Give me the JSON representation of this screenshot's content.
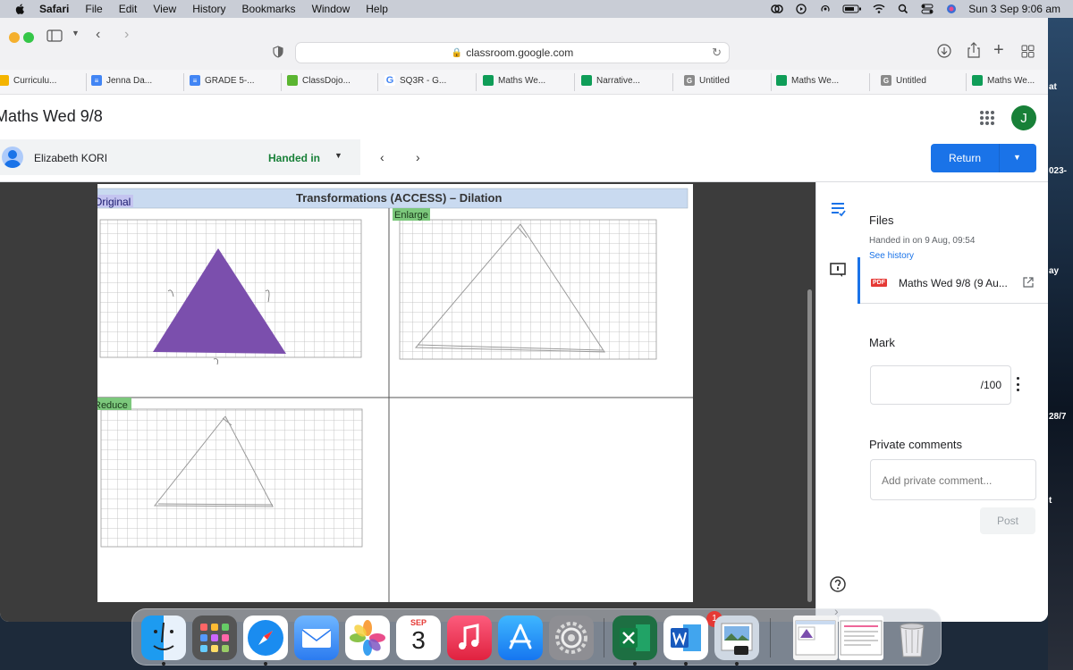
{
  "menubar": {
    "app": "Safari",
    "items": [
      "File",
      "Edit",
      "View",
      "History",
      "Bookmarks",
      "Window",
      "Help"
    ],
    "clock": "Sun 3 Sep  9:06 am"
  },
  "browser": {
    "url": "classroom.google.com",
    "favorites": [
      {
        "label": "Curriculu...",
        "icon": "drive-icon",
        "color": "#f4b400"
      },
      {
        "label": "Jenna Da...",
        "icon": "docs-icon",
        "color": "#4285f4"
      },
      {
        "label": "GRADE 5-...",
        "icon": "docs-icon",
        "color": "#4285f4"
      },
      {
        "label": "ClassDojo...",
        "icon": "classdojo-icon",
        "color": "#5bb531"
      },
      {
        "label": "SQ3R - G...",
        "icon": "google-icon",
        "color": "#4285f4"
      },
      {
        "label": "Maths We...",
        "icon": "classroom-icon",
        "color": "#0f9d58"
      },
      {
        "label": "Narrative...",
        "icon": "classroom-icon",
        "color": "#0f9d58"
      },
      {
        "label": "Untitled",
        "icon": "g-icon",
        "color": "#8a8a8a"
      },
      {
        "label": "Maths We...",
        "icon": "classroom-icon",
        "color": "#0f9d58"
      },
      {
        "label": "Untitled",
        "icon": "g-icon",
        "color": "#8a8a8a"
      },
      {
        "label": "Maths We...",
        "icon": "classroom-icon",
        "color": "#0f9d58"
      }
    ]
  },
  "classroom": {
    "title": "Maths Wed 9/8",
    "avatar_letter": "J",
    "student": "Elizabeth KORI",
    "status": "Handed in",
    "return_label": "Return"
  },
  "worksheet": {
    "heading": "Transformations (ACCESS) – Dilation",
    "labels": {
      "original": "Original",
      "enlarge": "Enlarge",
      "reduce": "Reduce"
    }
  },
  "panel": {
    "files_heading": "Files",
    "handed_in": "Handed in on 9 Aug, 09:54",
    "see_history": "See history",
    "file_badge": "PDF",
    "file_name": "Maths Wed 9/8 (9 Au...",
    "mark_heading": "Mark",
    "mark_suffix": "/100",
    "comments_heading": "Private comments",
    "comment_placeholder": "Add private comment...",
    "post_label": "Post"
  },
  "dock": {
    "calendar_month": "SEP",
    "calendar_day": "3",
    "settings_badge": "1"
  },
  "desktop_fragments": [
    "at",
    "023-",
    "ay",
    "28/7",
    "t"
  ],
  "colors": {
    "accent": "#1a73e8",
    "handed_in_green": "#188038",
    "triangle_fill": "#7b4fad"
  }
}
